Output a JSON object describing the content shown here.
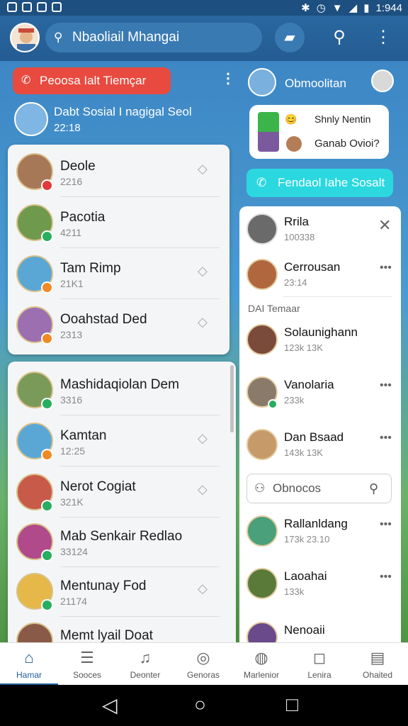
{
  "status": {
    "time": "1:944"
  },
  "appbar": {
    "title": "Nbaoliail Mhangai"
  },
  "left": {
    "pill": "Peoosa Ialt Tiemçar",
    "me": {
      "name": "Dabt Sosial I nagigal Seol",
      "time": "22:18"
    },
    "list1": [
      {
        "name": "Deole",
        "time": "2216"
      },
      {
        "name": "Pacotia",
        "time": "4211"
      },
      {
        "name": "Tam Rimp",
        "time": "21K1"
      },
      {
        "name": "Ooahstad Ded",
        "time": "2313"
      }
    ],
    "list2": [
      {
        "name": "Mashidaqiolan Dem",
        "time": "3316"
      },
      {
        "name": "Kamtan",
        "time": "12:25"
      },
      {
        "name": "Nerot Cogiat",
        "time": "321K"
      },
      {
        "name": "Mab Senkair Redlao",
        "time": "33124"
      },
      {
        "name": "Mentunay Fod",
        "time": "21174"
      },
      {
        "name": "Memt lyail Doat",
        "time": ""
      }
    ]
  },
  "right": {
    "top_name": "Obmoolitan",
    "bubble": {
      "line1": "Shnly Nentin",
      "line2": "Ganab Ovioi?"
    },
    "pill": "Fendaol Iahe Sosalt",
    "panel": {
      "header": {
        "name": "Rrila",
        "time": "100338"
      },
      "first": {
        "name": "Cerrousan",
        "time": "23:14"
      },
      "section": "DAI Temaar",
      "items": [
        {
          "name": "Solaunighann",
          "time": "123k 13K"
        },
        {
          "name": "Vanolaria",
          "time": "233k"
        },
        {
          "name": "Dan Bsaad",
          "time": "143k 13K"
        }
      ],
      "search_placeholder": "Obnocos",
      "items2": [
        {
          "name": "Rallanldang",
          "time": "173k 23.10"
        },
        {
          "name": "Laoahai",
          "time": "133k"
        },
        {
          "name": "Nenoaii",
          "time": ""
        }
      ]
    }
  },
  "nav": [
    {
      "label": "Hamar",
      "icon": "home-icon"
    },
    {
      "label": "Sooces",
      "icon": "list-icon"
    },
    {
      "label": "Deonter",
      "icon": "bell-icon"
    },
    {
      "label": "Genoras",
      "icon": "target-icon"
    },
    {
      "label": "Marlenior",
      "icon": "globe-icon"
    },
    {
      "label": "Lenira",
      "icon": "chat-icon"
    },
    {
      "label": "Ohaited",
      "icon": "doc-icon"
    }
  ],
  "colors": {
    "primary": "#1f5e9a",
    "red": "#e84a3f",
    "cyan": "#2bd8df"
  }
}
